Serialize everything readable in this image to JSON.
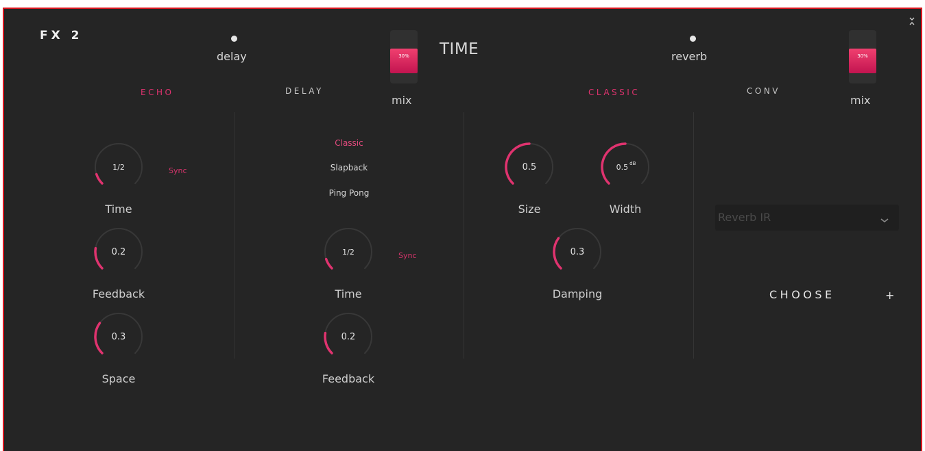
{
  "fx": {
    "title": "FX 2",
    "section": "TIME"
  },
  "delay": {
    "name": "delay",
    "mix": {
      "label": "mix",
      "value_text": "30%",
      "value": 30
    },
    "tabs": [
      "ECHO",
      "DELAY"
    ],
    "active_tab": "ECHO",
    "echo": {
      "time": {
        "value": "1/2",
        "label": "Time",
        "sync": "Sync"
      },
      "feedback": {
        "value": "0.2",
        "label": "Feedback"
      },
      "space": {
        "value": "0.3",
        "label": "Space"
      }
    },
    "delay_panel": {
      "modes": [
        "Classic",
        "Slapback",
        "Ping Pong"
      ],
      "active_mode": "Classic",
      "time": {
        "value": "1/2",
        "label": "Time",
        "sync": "Sync"
      },
      "feedback": {
        "value": "0.2",
        "label": "Feedback"
      }
    }
  },
  "reverb": {
    "name": "reverb",
    "mix": {
      "label": "mix",
      "value_text": "30%",
      "value": 30
    },
    "tabs": [
      "CLASSIC",
      "CONV"
    ],
    "active_tab": "CLASSIC",
    "classic": {
      "size": {
        "value": "0.5",
        "label": "Size"
      },
      "width": {
        "value": "0.5",
        "unit": "dB",
        "label": "Width"
      },
      "damping": {
        "value": "0.3",
        "label": "Damping"
      }
    },
    "conv": {
      "ir_placeholder": "Reverb IR",
      "choose_label": "CHOOSE",
      "add_symbol": "+"
    }
  },
  "colors": {
    "accent": "#e0336f",
    "background": "#252525",
    "border": "#d8151e",
    "track": "#383838"
  },
  "icons": {
    "collapse": "collapse-icon",
    "chevron": "chevron-down-icon"
  }
}
